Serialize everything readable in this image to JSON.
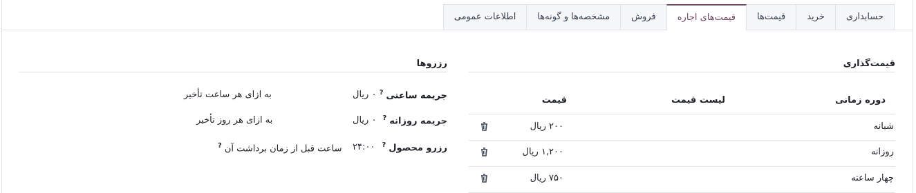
{
  "tabs": [
    {
      "label": "اطلاعات عمومی",
      "active": false
    },
    {
      "label": "مشخصه‌ها و گونه‌ها",
      "active": false
    },
    {
      "label": "فروش",
      "active": false
    },
    {
      "label": "قیمت‌های اجاره",
      "active": true
    },
    {
      "label": "قیمت‌ها",
      "active": false
    },
    {
      "label": "خرید",
      "active": false
    },
    {
      "label": "حسابداری",
      "active": false
    }
  ],
  "pricing": {
    "title": "قیمت‌گذاری",
    "columns": {
      "period": "دوره زمانی",
      "pricelist": "لیست قیمت",
      "price": "قیمت"
    },
    "rows": [
      {
        "period": "شبانه",
        "pricelist": "",
        "price": "۲۰۰ ریال"
      },
      {
        "period": "روزانه",
        "pricelist": "",
        "price": "۱,۲۰۰ ریال"
      },
      {
        "period": "چهار ساعته",
        "pricelist": "",
        "price": "۷۵۰ ریال"
      }
    ]
  },
  "reservations": {
    "title": "رزروها",
    "hourly_fine": {
      "label": "جریمه ساعتی",
      "help": "?",
      "value": "۰ ریال",
      "note": "به ازای هر ساعت تأخیر"
    },
    "daily_fine": {
      "label": "جریمه روزانه",
      "help": "?",
      "value": "۰ ریال",
      "note": "به ازای هر روز تأخیر"
    },
    "product_reservation": {
      "label": "رزرو محصول",
      "help": "?",
      "value": "۲۴:۰۰",
      "note": "ساعت قبل از زمان برداشت آن",
      "note_help": "?"
    }
  },
  "colors": {
    "accent": "#714b67",
    "border": "#dee2e6"
  },
  "icons": {
    "delete": "trash-icon"
  }
}
